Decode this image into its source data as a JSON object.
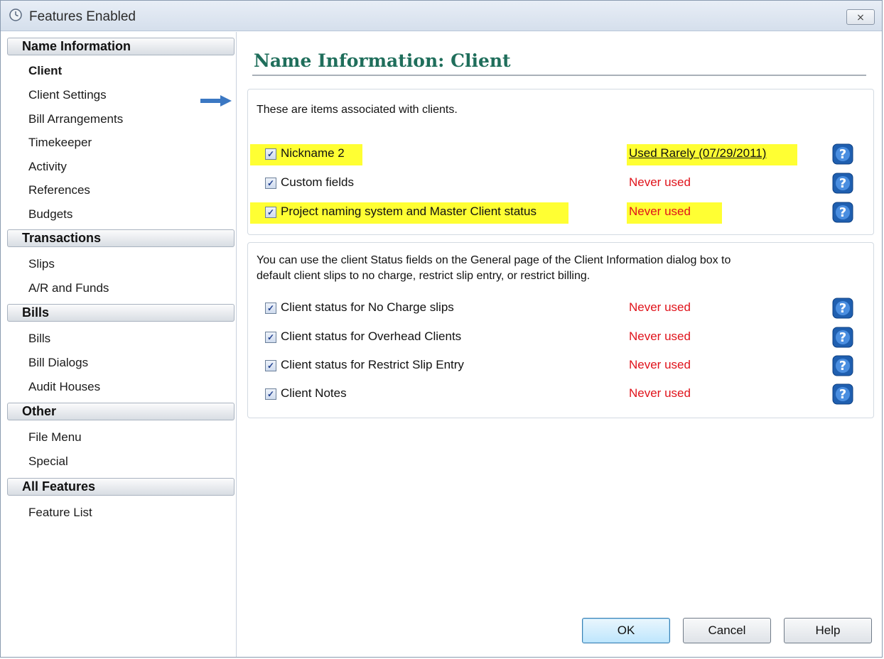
{
  "window": {
    "title": "Features Enabled",
    "close_label": "⨯"
  },
  "sidebar": {
    "groups": [
      {
        "label": "Name Information",
        "items": [
          "Client",
          "Client Settings",
          "Bill Arrangements",
          "Timekeeper",
          "Activity",
          "References",
          "Budgets"
        ]
      },
      {
        "label": "Transactions",
        "items": [
          "Slips",
          "A/R and Funds"
        ]
      },
      {
        "label": "Bills",
        "items": [
          "Bills",
          "Bill Dialogs",
          "Audit Houses"
        ]
      },
      {
        "label": "Other",
        "items": [
          "File Menu",
          "Special"
        ]
      },
      {
        "label": "All Features",
        "items": [
          "Feature List"
        ]
      }
    ],
    "selected": "Client"
  },
  "main": {
    "title": "Name Information: Client",
    "panel1": {
      "description": "These are items associated with clients.",
      "rows": [
        {
          "label": "Nickname 2",
          "status": "Used Rarely (07/29/2011)",
          "checked": true
        },
        {
          "label": "Custom fields",
          "status": "Never used",
          "checked": true
        },
        {
          "label": "Project naming system and Master Client status",
          "status": "Never used",
          "checked": true
        }
      ]
    },
    "panel2": {
      "description_line1": "You can use the client Status fields on the General page of the Client Information dialog box to",
      "description_line2": "default client slips to no charge, restrict slip entry, or restrict billing.",
      "rows": [
        {
          "label": "Client status for No Charge slips",
          "status": "Never used",
          "checked": true
        },
        {
          "label": "Client status for Overhead Clients",
          "status": "Never used",
          "checked": true
        },
        {
          "label": "Client status for Restrict Slip Entry",
          "status": "Never used",
          "checked": true
        },
        {
          "label": "Client Notes",
          "status": "Never used",
          "checked": true
        }
      ]
    }
  },
  "buttons": {
    "ok": "OK",
    "cancel": "Cancel",
    "help": "Help"
  },
  "colors": {
    "heading": "#1f6e5b",
    "status_never": "#e0131b",
    "highlight": "#ffff33"
  },
  "icons": {
    "window": "clock-icon",
    "selected_indicator": "arrow-right-icon",
    "row_help": "help-question-icon"
  }
}
